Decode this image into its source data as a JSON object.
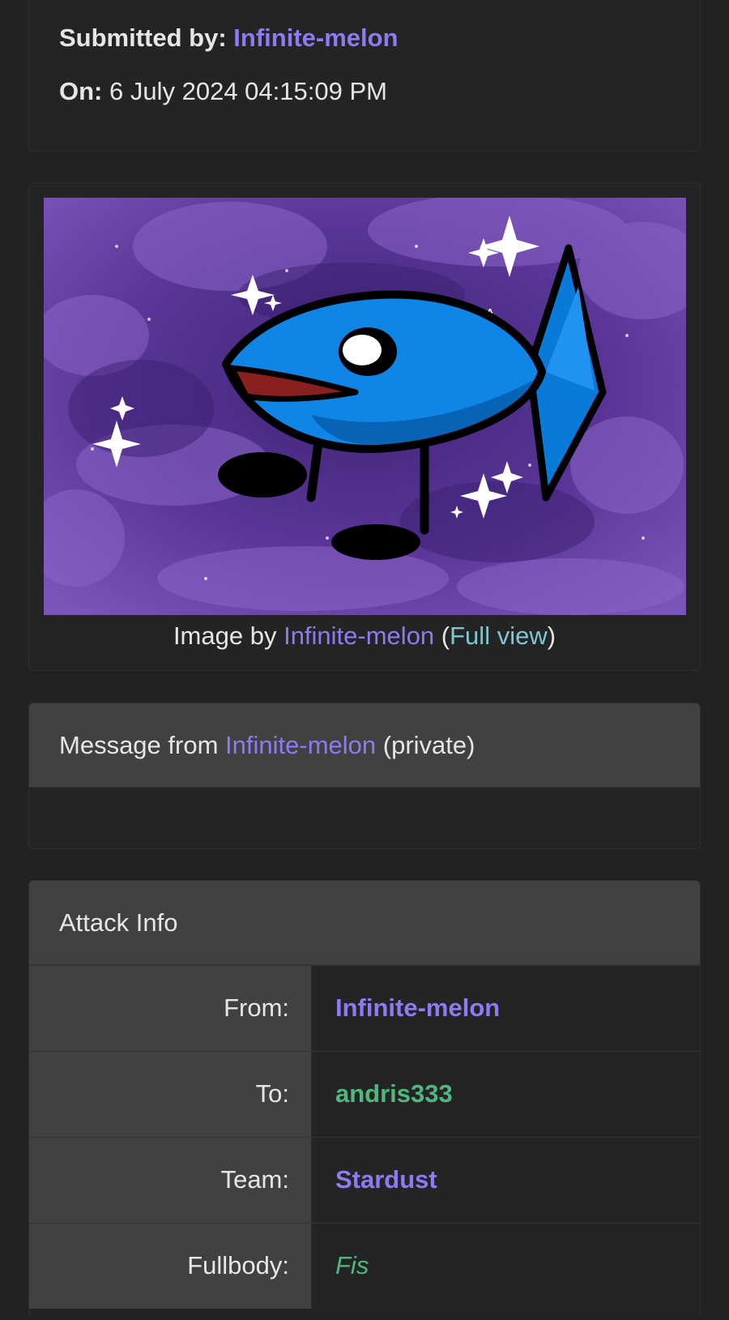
{
  "submission": {
    "submitted_label": "Submitted by:",
    "submitted_user": "Infinite-melon",
    "on_label": "On:",
    "on_value": "6 July 2024 04:15:09 PM"
  },
  "image": {
    "caption_prefix": "Image by",
    "caption_user": "Infinite-melon",
    "open_paren": "(",
    "full_view_label": "Full view",
    "close_paren": ")",
    "sign": "AA"
  },
  "message": {
    "prefix": "Message from",
    "user": "Infinite-melon",
    "suffix": "(private)"
  },
  "attack_info": {
    "title": "Attack Info",
    "rows": [
      {
        "label": "From:",
        "value": "Infinite-melon",
        "color": "#8c7bf2"
      },
      {
        "label": "To:",
        "value": "andris333",
        "color": "#4fb87e"
      },
      {
        "label": "Team:",
        "value": "Stardust",
        "color": "#8c7bf2"
      },
      {
        "label": "Fullbody:",
        "value": "Fis",
        "color": "#4fb87e"
      }
    ]
  },
  "colors": {
    "background": "#222222",
    "card": "#242424",
    "header": "#414141",
    "link_purple": "#8c7bf2",
    "link_teal": "#7fc6d4",
    "link_green": "#4fb87e"
  }
}
